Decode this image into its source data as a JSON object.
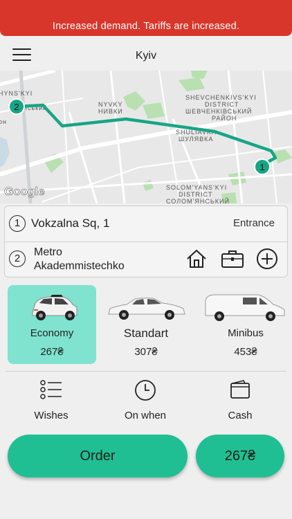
{
  "banner": {
    "message": "Increased demand. Tariffs are increased."
  },
  "header": {
    "city": "Kyiv",
    "menu_icon": "menu-icon"
  },
  "map": {
    "labels": {
      "district_left_1": "HYNS'KYI",
      "district_left_2": "нський",
      "district_left_3": "он",
      "nyvky_en": "NYVKY",
      "nyvky_uk": "НИВКИ",
      "shevchenko_1": "SHEVCHENKIVS'KYI",
      "shevchenko_2": "DISTRICT",
      "shevchenko_3": "ШЕВЧЕНКІВСЬКИЙ",
      "shevchenko_4": "РАЙОН",
      "shuliavka_en": "SHULIAVKA",
      "shuliavka_uk": "ШУЛЯВКА",
      "solom_1": "SOLOM'YANS'KYI",
      "solom_2": "DISTRICT",
      "solom_3": "СОЛОМ'ЯНСЬКИЙ",
      "google": "Google"
    },
    "marker_start": "1",
    "marker_end": "2",
    "route_color": "#17a586"
  },
  "addresses": [
    {
      "number": "1",
      "text": "Vokzalna Sq, 1",
      "entrance_label": "Entrance"
    },
    {
      "number": "2",
      "line1": "Metro",
      "line2": "Akademmistechko"
    }
  ],
  "address_actions": [
    {
      "icon": "home-icon"
    },
    {
      "icon": "briefcase-icon"
    },
    {
      "icon": "plus-icon"
    }
  ],
  "tariffs": [
    {
      "name": "Economy",
      "price": "267₴",
      "selected": true
    },
    {
      "name": "Standart",
      "price": "307₴",
      "selected": false
    },
    {
      "name": "Minibus",
      "price": "453₴",
      "selected": false
    }
  ],
  "options": [
    {
      "label": "Wishes",
      "icon": "list-icon"
    },
    {
      "label": "On when",
      "icon": "clock-icon"
    },
    {
      "label": "Cash",
      "icon": "wallet-icon"
    }
  ],
  "order": {
    "label": "Order",
    "price": "267₴"
  },
  "colors": {
    "accent": "#1fbf93",
    "selected_tariff": "#7fe3cf",
    "banner": "#d9362b"
  }
}
